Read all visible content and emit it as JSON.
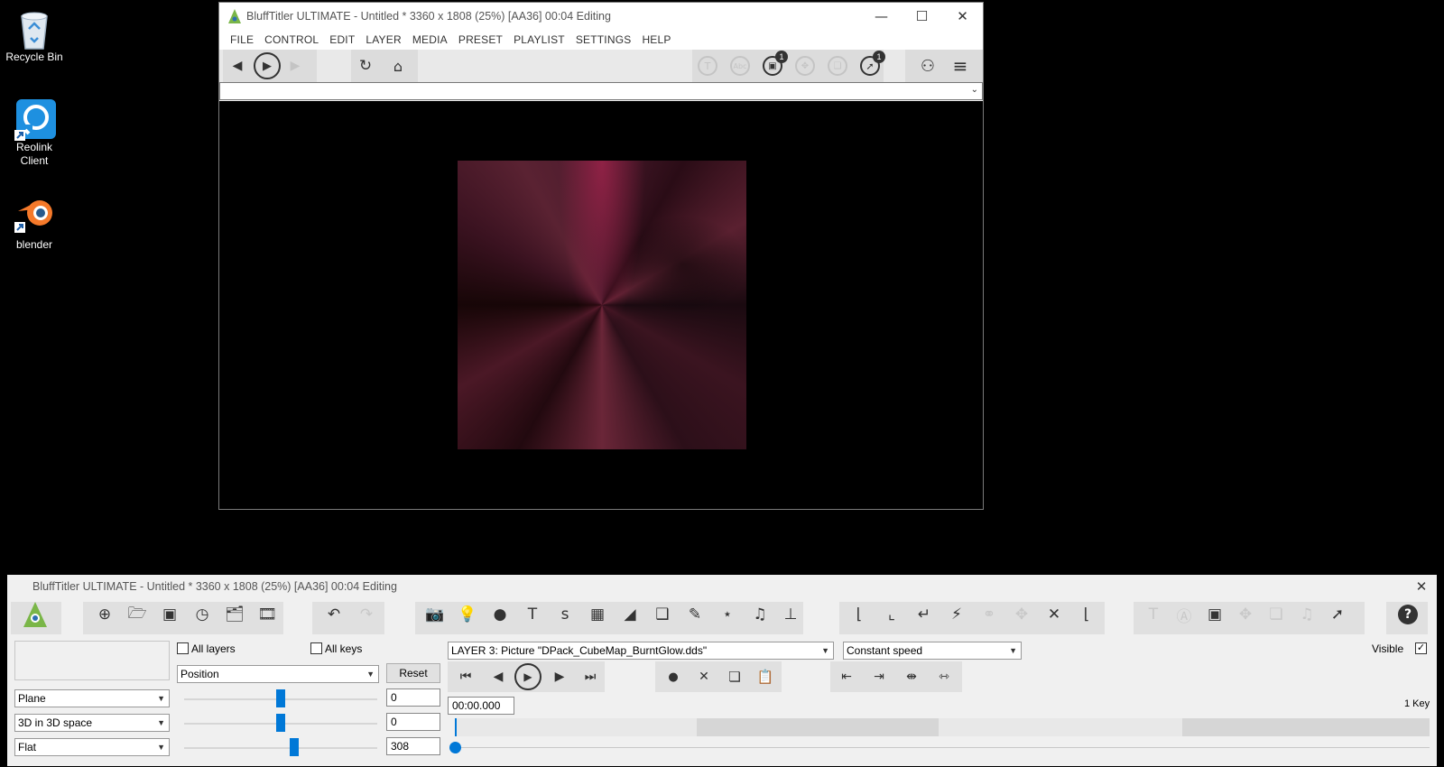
{
  "desktop": {
    "icons": [
      {
        "label": "Recycle Bin",
        "icon": "recycle-bin-icon"
      },
      {
        "label": "Reolink Client",
        "icon": "reolink-icon"
      },
      {
        "label": "blender",
        "icon": "blender-icon"
      }
    ]
  },
  "preview_window": {
    "title": "BluffTitler ULTIMATE  - Untitled * 3360 x 1808 (25%) [AA36] 00:04 Editing",
    "menu": [
      "FILE",
      "CONTROL",
      "EDIT",
      "LAYER",
      "MEDIA",
      "PRESET",
      "PLAYLIST",
      "SETTINGS",
      "HELP"
    ],
    "badges": {
      "media_count": "1",
      "tools_count": "1"
    },
    "combo_value": ""
  },
  "editor_window": {
    "title": "BluffTitler ULTIMATE  - Untitled * 3360 x 1808 (25%) [AA36] 00:04 Editing",
    "all_layers_label": "All layers",
    "all_keys_label": "All keys",
    "property_select": "Position",
    "reset_label": "Reset",
    "layer_select": "LAYER 3: Picture \"DPack_CubeMap_BurntGlow.dds\"",
    "speed_select": "Constant speed",
    "visible_label": "Visible",
    "visible_checked": true,
    "shape_select": "Plane",
    "space_select": "3D in 3D space",
    "shading_select": "Flat",
    "values": [
      "0",
      "0",
      "308"
    ],
    "slider_levels": [
      0.5,
      0.5,
      0.57
    ],
    "time": "00:00.000",
    "keys_label": "1 Key"
  },
  "colors": {
    "accent": "#0078d7",
    "toolbar_group": "#dcdcdc"
  }
}
